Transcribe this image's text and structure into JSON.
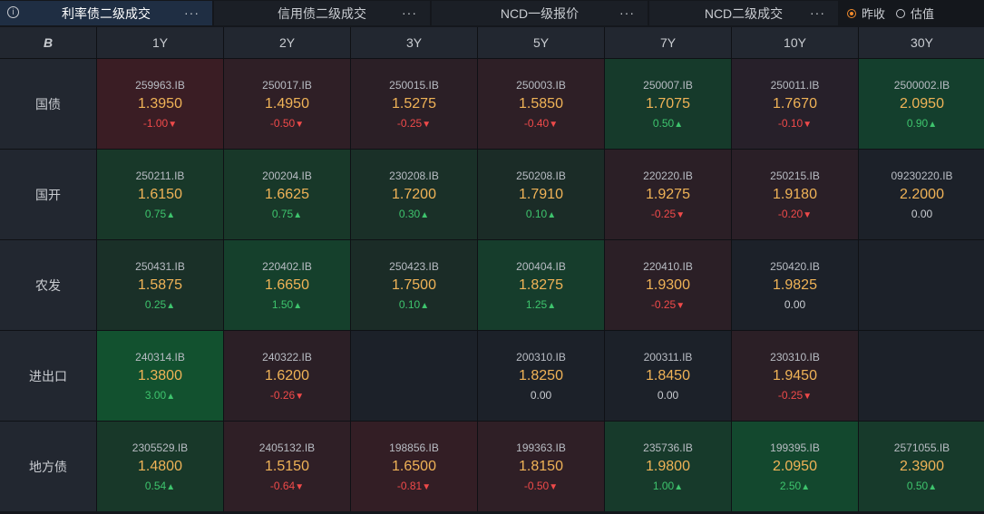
{
  "tabs": [
    {
      "label": "利率债二级成交",
      "active": true,
      "more": "···",
      "info": "i",
      "width": 234
    },
    {
      "label": "信用债二级成交",
      "active": false,
      "more": "···",
      "width": 238
    },
    {
      "label": "NCD一级报价",
      "active": false,
      "more": "···",
      "width": 238
    },
    {
      "label": "NCD二级成交",
      "active": false,
      "more": "···",
      "width": 208
    }
  ],
  "radios": [
    {
      "label": "昨收",
      "checked": true
    },
    {
      "label": "估值",
      "checked": false
    }
  ],
  "table": {
    "corner": "B",
    "columns": [
      "1Y",
      "2Y",
      "3Y",
      "5Y",
      "7Y",
      "10Y",
      "30Y"
    ],
    "rows": [
      {
        "label": "国债",
        "cells": [
          {
            "code": "259963.IB",
            "yield": "1.3950",
            "chg": "-1.00",
            "dir": "down",
            "bg": "#3a1d24"
          },
          {
            "code": "250017.IB",
            "yield": "1.4950",
            "chg": "-0.50",
            "dir": "down",
            "bg": "#2f1f26"
          },
          {
            "code": "250015.IB",
            "yield": "1.5275",
            "chg": "-0.25",
            "dir": "down",
            "bg": "#2b1f26"
          },
          {
            "code": "250003.IB",
            "yield": "1.5850",
            "chg": "-0.40",
            "dir": "down",
            "bg": "#2e1f26"
          },
          {
            "code": "250007.IB",
            "yield": "1.7075",
            "chg": "0.50",
            "dir": "up",
            "bg": "#163a2b"
          },
          {
            "code": "250011.IB",
            "yield": "1.7670",
            "chg": "-0.10",
            "dir": "down",
            "bg": "#27202a"
          },
          {
            "code": "2500002.IB",
            "yield": "2.0950",
            "chg": "0.90",
            "dir": "up",
            "bg": "#143f2d"
          }
        ]
      },
      {
        "label": "国开",
        "cells": [
          {
            "code": "250211.IB",
            "yield": "1.6150",
            "chg": "0.75",
            "dir": "up",
            "bg": "#183829"
          },
          {
            "code": "200204.IB",
            "yield": "1.6625",
            "chg": "0.75",
            "dir": "up",
            "bg": "#183829"
          },
          {
            "code": "230208.IB",
            "yield": "1.7200",
            "chg": "0.30",
            "dir": "up",
            "bg": "#1a3028"
          },
          {
            "code": "250208.IB",
            "yield": "1.7910",
            "chg": "0.10",
            "dir": "up",
            "bg": "#1b2c27"
          },
          {
            "code": "220220.IB",
            "yield": "1.9275",
            "chg": "-0.25",
            "dir": "down",
            "bg": "#2b1f26"
          },
          {
            "code": "250215.IB",
            "yield": "1.9180",
            "chg": "-0.20",
            "dir": "down",
            "bg": "#2a1f27"
          },
          {
            "code": "09230220.IB",
            "yield": "2.2000",
            "chg": "0.00",
            "dir": "flat",
            "bg": "#1c2129"
          }
        ]
      },
      {
        "label": "农发",
        "cells": [
          {
            "code": "250431.IB",
            "yield": "1.5875",
            "chg": "0.25",
            "dir": "up",
            "bg": "#1a3028"
          },
          {
            "code": "220402.IB",
            "yield": "1.6650",
            "chg": "1.50",
            "dir": "up",
            "bg": "#15402c"
          },
          {
            "code": "250423.IB",
            "yield": "1.7500",
            "chg": "0.10",
            "dir": "up",
            "bg": "#1b2c27"
          },
          {
            "code": "200404.IB",
            "yield": "1.8275",
            "chg": "1.25",
            "dir": "up",
            "bg": "#163d2c"
          },
          {
            "code": "220410.IB",
            "yield": "1.9300",
            "chg": "-0.25",
            "dir": "down",
            "bg": "#2b1f26"
          },
          {
            "code": "250420.IB",
            "yield": "1.9825",
            "chg": "0.00",
            "dir": "flat",
            "bg": "#1c2129"
          },
          {
            "empty": true,
            "bg": "#1c2129"
          }
        ]
      },
      {
        "label": "进出口",
        "cells": [
          {
            "code": "240314.IB",
            "yield": "1.3800",
            "chg": "3.00",
            "dir": "up",
            "bg": "#12512f"
          },
          {
            "code": "240322.IB",
            "yield": "1.6200",
            "chg": "-0.26",
            "dir": "down",
            "bg": "#2b1f26"
          },
          {
            "empty": true,
            "bg": "#1c2129"
          },
          {
            "code": "200310.IB",
            "yield": "1.8250",
            "chg": "0.00",
            "dir": "flat",
            "bg": "#1c2129"
          },
          {
            "code": "200311.IB",
            "yield": "1.8450",
            "chg": "0.00",
            "dir": "flat",
            "bg": "#1c2129"
          },
          {
            "code": "230310.IB",
            "yield": "1.9450",
            "chg": "-0.25",
            "dir": "down",
            "bg": "#2b1f26"
          },
          {
            "empty": true,
            "bg": "#1c2129"
          }
        ]
      },
      {
        "label": "地方债",
        "cells": [
          {
            "code": "2305529.IB",
            "yield": "1.4800",
            "chg": "0.54",
            "dir": "up",
            "bg": "#183829"
          },
          {
            "code": "2405132.IB",
            "yield": "1.5150",
            "chg": "-0.64",
            "dir": "down",
            "bg": "#2f1f26"
          },
          {
            "code": "198856.IB",
            "yield": "1.6500",
            "chg": "-0.81",
            "dir": "down",
            "bg": "#331e25"
          },
          {
            "code": "199363.IB",
            "yield": "1.8150",
            "chg": "-0.50",
            "dir": "down",
            "bg": "#2f1f26"
          },
          {
            "code": "235736.IB",
            "yield": "1.9800",
            "chg": "1.00",
            "dir": "up",
            "bg": "#173a2b"
          },
          {
            "code": "199395.IB",
            "yield": "2.0950",
            "chg": "2.50",
            "dir": "up",
            "bg": "#13482e"
          },
          {
            "code": "2571055.IB",
            "yield": "2.3900",
            "chg": "0.50",
            "dir": "up",
            "bg": "#173a2b"
          }
        ]
      }
    ]
  },
  "colors": {
    "up": "#3ec46d",
    "down": "#ef4a4a",
    "yield": "#f0b357",
    "accent": "#f08a2c"
  },
  "icons": {
    "up": "triangle-up-icon",
    "down": "triangle-down-icon",
    "info": "info-icon",
    "more": "more-dots-icon"
  }
}
